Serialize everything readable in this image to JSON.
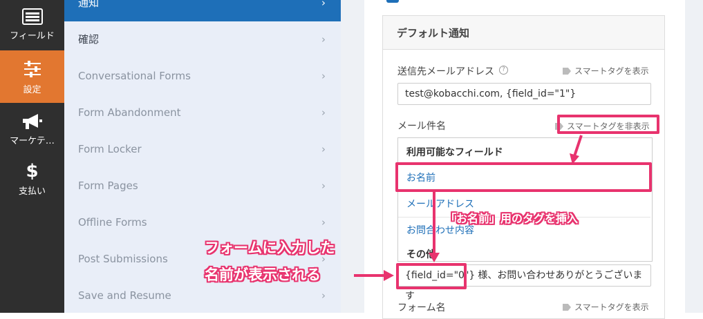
{
  "rail": {
    "items": [
      {
        "label": "フィールド",
        "icon": "fields-icon"
      },
      {
        "label": "設定",
        "icon": "sliders-icon"
      },
      {
        "label": "マーケテ…",
        "icon": "megaphone-icon"
      },
      {
        "label": "支払い",
        "icon": "dollar-icon",
        "glyph": "$"
      }
    ]
  },
  "menu": {
    "items": [
      {
        "label": "通知"
      },
      {
        "label": "確認"
      },
      {
        "label": "Conversational Forms"
      },
      {
        "label": "Form Abandonment"
      },
      {
        "label": "Form Locker"
      },
      {
        "label": "Form Pages"
      },
      {
        "label": "Offline Forms"
      },
      {
        "label": "Post Submissions"
      },
      {
        "label": "Save and Resume"
      }
    ],
    "chevron": "›"
  },
  "panel": {
    "title": "デフォルト通知",
    "to_label": "送信先メールアドレス",
    "help_glyph": "?",
    "show_smart_tags": "スマートタグを表示",
    "hide_smart_tags": "スマートタグを非表示",
    "to_value": "test@kobacchi.com, {field_id=\"1\"}",
    "subject_label": "メール件名",
    "dropdown": {
      "heading": "利用可能なフィールド",
      "items": [
        "お名前",
        "メールアドレス",
        "お問合わせ内容"
      ],
      "other_heading": "その他"
    },
    "subject_value_prefix": "{field_id=\"0\"}",
    "subject_value_rest": "様、お問い合わせありがとうございます",
    "form_name_label": "フォーム名"
  },
  "annotations": {
    "tag_insert": "「お名前」用のタグを挿入",
    "line1": "フォームに入力した",
    "line2": "名前が表示される"
  },
  "colors": {
    "accent_orange": "#e27730",
    "accent_blue": "#1e6fb8",
    "highlight_pink": "#e8336e"
  }
}
